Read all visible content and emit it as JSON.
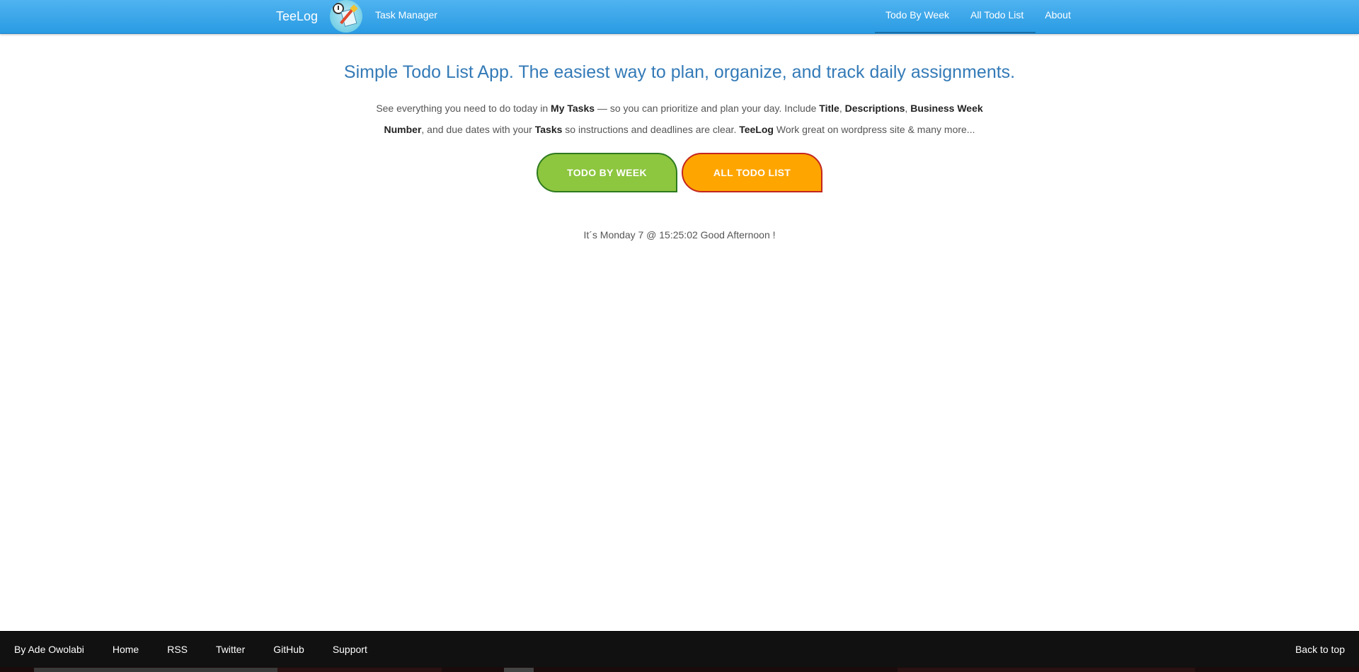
{
  "header": {
    "brand": "TeeLog",
    "tagline": "Task Manager",
    "nav": [
      {
        "label": "Todo By Week"
      },
      {
        "label": "All Todo List"
      },
      {
        "label": "About"
      }
    ]
  },
  "main": {
    "headline": "Simple Todo List App. The easiest way to plan, organize, and track daily assignments.",
    "intro": {
      "t1": "See everything you need to do today in ",
      "b1": "My Tasks",
      "t2": " — so you can prioritize and plan your day. Include ",
      "b2": "Title",
      "t3": ", ",
      "b3": "Descriptions",
      "t4": ", ",
      "b4": "Business Week Number",
      "t5": ", and due dates with your ",
      "b5": "Tasks",
      "t6": " so instructions and deadlines are clear. ",
      "b6": "TeeLog",
      "t7": " Work great on wordpress site & many more..."
    },
    "buttons": {
      "todo_by_week": "Todo By Week",
      "all_todo_list": "All Todo List"
    },
    "greeting": "It´s Monday 7 @ 15:25:02 Good Afternoon !"
  },
  "footer": {
    "links": [
      {
        "label": "By Ade Owolabi"
      },
      {
        "label": "Home"
      },
      {
        "label": "RSS"
      },
      {
        "label": "Twitter"
      },
      {
        "label": "GitHub"
      },
      {
        "label": "Support"
      }
    ],
    "back_to_top": "Back to top"
  },
  "colors": {
    "header_blue": "#2a9be3",
    "headline_blue": "#337ab7",
    "green_button": "#8dc63f",
    "orange_button": "#ffa500",
    "footer_bg": "#111111"
  }
}
